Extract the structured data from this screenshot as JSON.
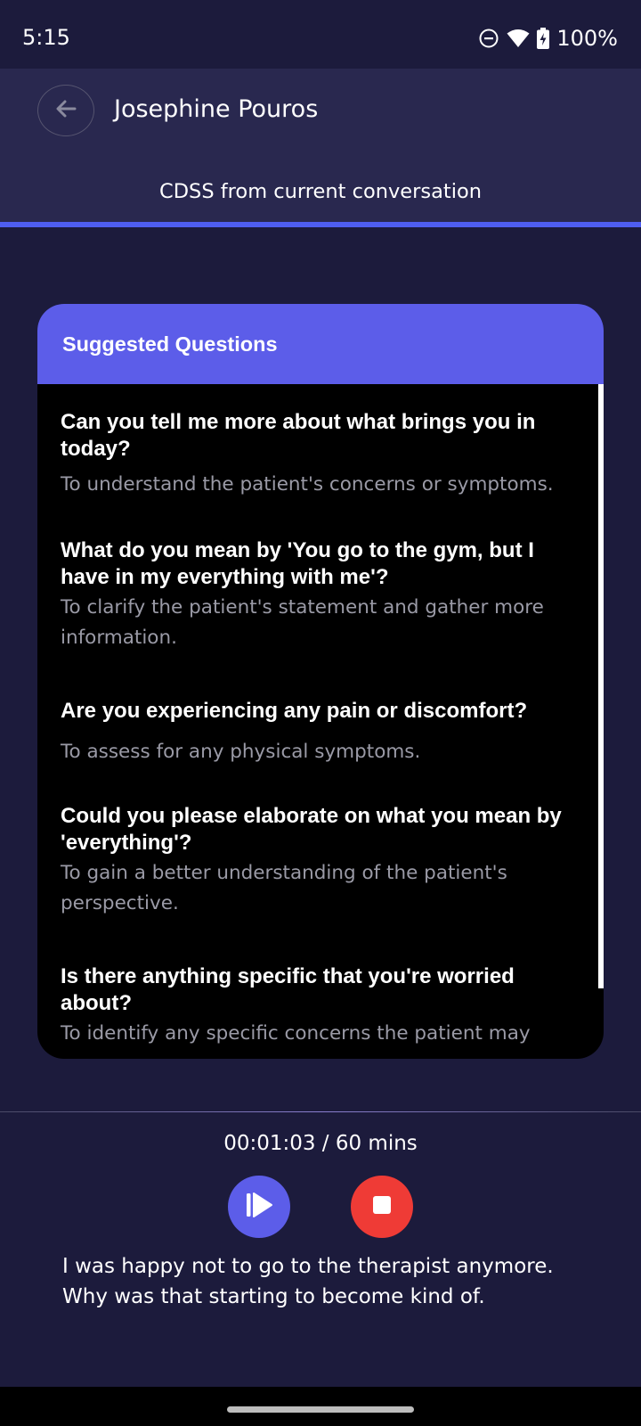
{
  "status_bar": {
    "time": "5:15",
    "battery": "100%",
    "icons": [
      "do-not-disturb-icon",
      "wifi-icon",
      "battery-charging-icon"
    ]
  },
  "header": {
    "back_icon": "arrow-left-icon",
    "title": "Josephine Pouros",
    "tab_label": "CDSS from current conversation"
  },
  "card": {
    "title": "Suggested Questions",
    "questions": [
      {
        "question": "Can you tell me more about what brings you in today?",
        "reason": "To understand the patient's concerns or symptoms."
      },
      {
        "question": "What do you mean by 'You go to the gym, but I have in my everything with me'?",
        "reason": "To clarify the patient's statement and gather more information."
      },
      {
        "question": "Are you experiencing any pain or discomfort?",
        "reason": "To assess for any physical symptoms."
      },
      {
        "question": "Could you please elaborate on what you mean by 'everything'?",
        "reason": "To gain a better understanding of the patient's perspective."
      },
      {
        "question": "Is there anything specific that you're worried about?",
        "reason": "To identify any specific concerns the patient may"
      }
    ]
  },
  "recorder": {
    "timer": "00:01:03 / 60 mins",
    "play_icon": "play-resume-icon",
    "stop_icon": "stop-icon"
  },
  "transcript": {
    "text": "I was happy not to go to the therapist anymore. Why was that starting to become kind of."
  },
  "colors": {
    "background": "#1c1b3c",
    "header_bg": "#29284f",
    "accent": "#5c5de9",
    "stop": "#ef3b36"
  }
}
